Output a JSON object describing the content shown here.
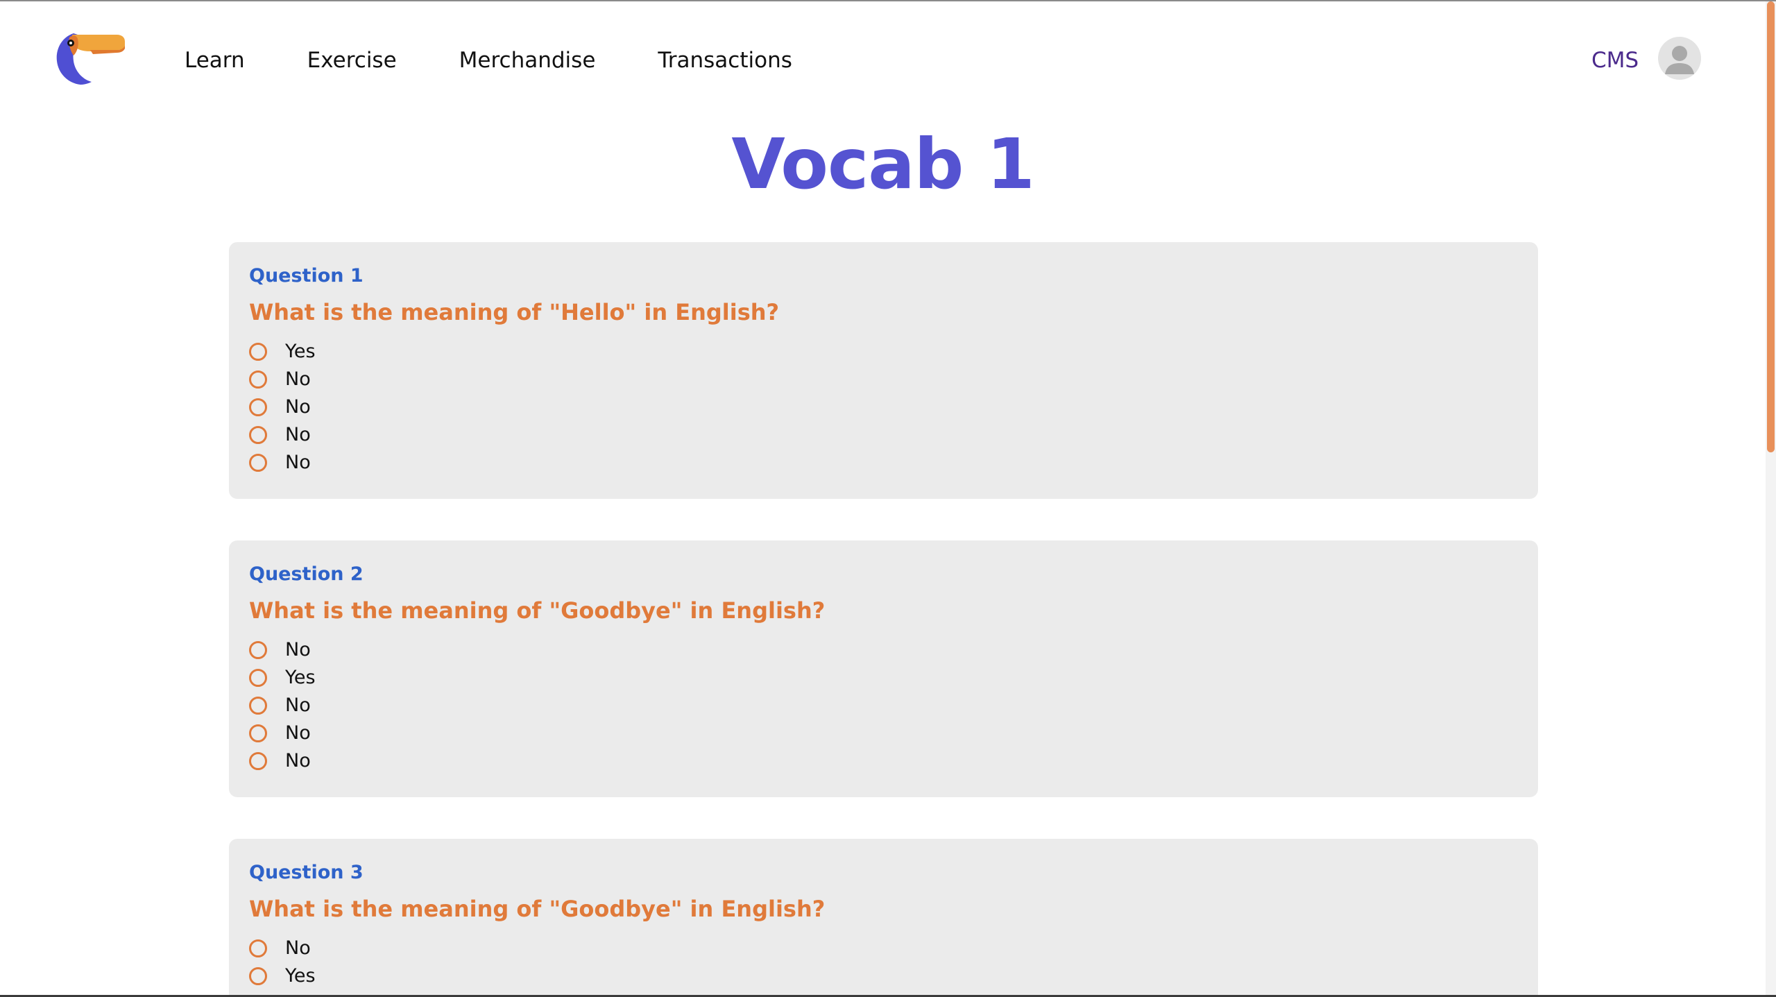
{
  "nav": {
    "links": [
      "Learn",
      "Exercise",
      "Merchandise",
      "Transactions"
    ],
    "cms_label": "CMS"
  },
  "page": {
    "title": "Vocab 1"
  },
  "questions": [
    {
      "number": "Question 1",
      "text": "What is the meaning of \"Hello\" in English?",
      "options": [
        "Yes",
        "No",
        "No",
        "No",
        "No"
      ]
    },
    {
      "number": "Question 2",
      "text": "What is the meaning of \"Goodbye\" in English?",
      "options": [
        "No",
        "Yes",
        "No",
        "No",
        "No"
      ]
    },
    {
      "number": "Question 3",
      "text": "What is the meaning of \"Goodbye\" in English?",
      "options": [
        "No",
        "Yes"
      ]
    }
  ],
  "colors": {
    "title": "#5553d1",
    "question_number": "#2e62c9",
    "question_text": "#e07a3a",
    "radio_border": "#e07a3a",
    "card_background": "#ebebeb",
    "cms_link": "#4b2a8c",
    "scrollbar_thumb": "#e8905a"
  },
  "icons": {
    "logo": "toucan-logo-icon",
    "avatar": "user-avatar-icon",
    "radio": "radio-unchecked-icon"
  }
}
